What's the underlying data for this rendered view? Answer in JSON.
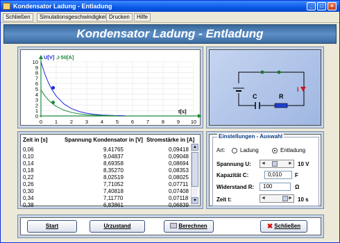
{
  "window": {
    "title": "Kondensator Ladung - Entladung"
  },
  "menu": [
    "Schließen",
    "Simulationsgeschwindigkeit",
    "Drucken",
    "Hilfe"
  ],
  "header": {
    "title": "Kondensator Ladung - Entladung"
  },
  "chart_data": {
    "type": "line",
    "ylabel_u": "U[V]",
    "ylabel_i": ",I·50[A]",
    "xlabel": "t[s]",
    "xlim": [
      0,
      10
    ],
    "ylim": [
      0,
      10
    ],
    "x_ticks": [
      "0",
      "1",
      "2",
      "3",
      "4",
      "5",
      "6",
      "7",
      "8",
      "9",
      "10"
    ],
    "y_ticks": [
      "0",
      "1",
      "2",
      "3",
      "4",
      "5",
      "6",
      "7",
      "8",
      "9",
      "10"
    ],
    "series": [
      {
        "color": "#1f2bd6",
        "x": [
          0,
          0.25,
          0.5,
          0.75,
          1,
          1.5,
          2,
          2.5,
          3,
          3.5,
          4,
          4.5,
          5,
          5.5
        ],
        "y": [
          10,
          7.79,
          6.07,
          4.72,
          3.68,
          2.23,
          1.35,
          0.82,
          0.5,
          0.3,
          0.18,
          0.11,
          0.07,
          0.04
        ],
        "marker": [
          0.8,
          5.2
        ]
      },
      {
        "color": "#1a8a3a",
        "x": [
          0,
          0.25,
          0.5,
          0.75,
          1,
          1.5,
          2,
          2.5,
          3,
          3.5,
          4,
          4.5,
          5
        ],
        "y": [
          4.8,
          3.74,
          2.91,
          2.27,
          1.77,
          1.07,
          0.65,
          0.39,
          0.24,
          0.14,
          0.09,
          0.05,
          0.03
        ],
        "marker": [
          0.8,
          2.5
        ]
      }
    ]
  },
  "circuit": {
    "c_label": "C",
    "r_label": "R",
    "i_label": "I"
  },
  "table": {
    "headers": [
      "Zeit in [s]",
      "Spannung Kondensator in [V]",
      "Stromstärke in [A]"
    ],
    "rows": [
      [
        "0,06",
        "9,41765",
        "0,09418"
      ],
      [
        "0,10",
        "9,04837",
        "0,09048"
      ],
      [
        "0,14",
        "8,69358",
        "0,08694"
      ],
      [
        "0,18",
        "8,35270",
        "0,08353"
      ],
      [
        "0,22",
        "8,02519",
        "0,08025"
      ],
      [
        "0,26",
        "7,71052",
        "0,07711"
      ],
      [
        "0,30",
        "7,40818",
        "0,07408"
      ],
      [
        "0,34",
        "7,11770",
        "0,07118"
      ],
      [
        "0,38",
        "6,83861",
        "0,06839"
      ]
    ]
  },
  "settings": {
    "title": "Einstellungen - Auswahl",
    "art_label": "Art:",
    "ladung": "Ladung",
    "entladung": "Entladung",
    "spannung_label": "Spannung U:",
    "spannung_value": "10 V",
    "kapazitaet_label": "Kapazität C:",
    "kapazitaet_value": "0,010",
    "kapazitaet_unit": "F",
    "widerstand_label": "Widerstand R:",
    "widerstand_value": "100",
    "widerstand_unit": "Ω",
    "zeit_label": "Zeit t:",
    "zeit_value": "10 s"
  },
  "buttons": {
    "start": "Start",
    "reset": "Urzustand",
    "calc": "Berechnen",
    "close": "Schließen"
  }
}
